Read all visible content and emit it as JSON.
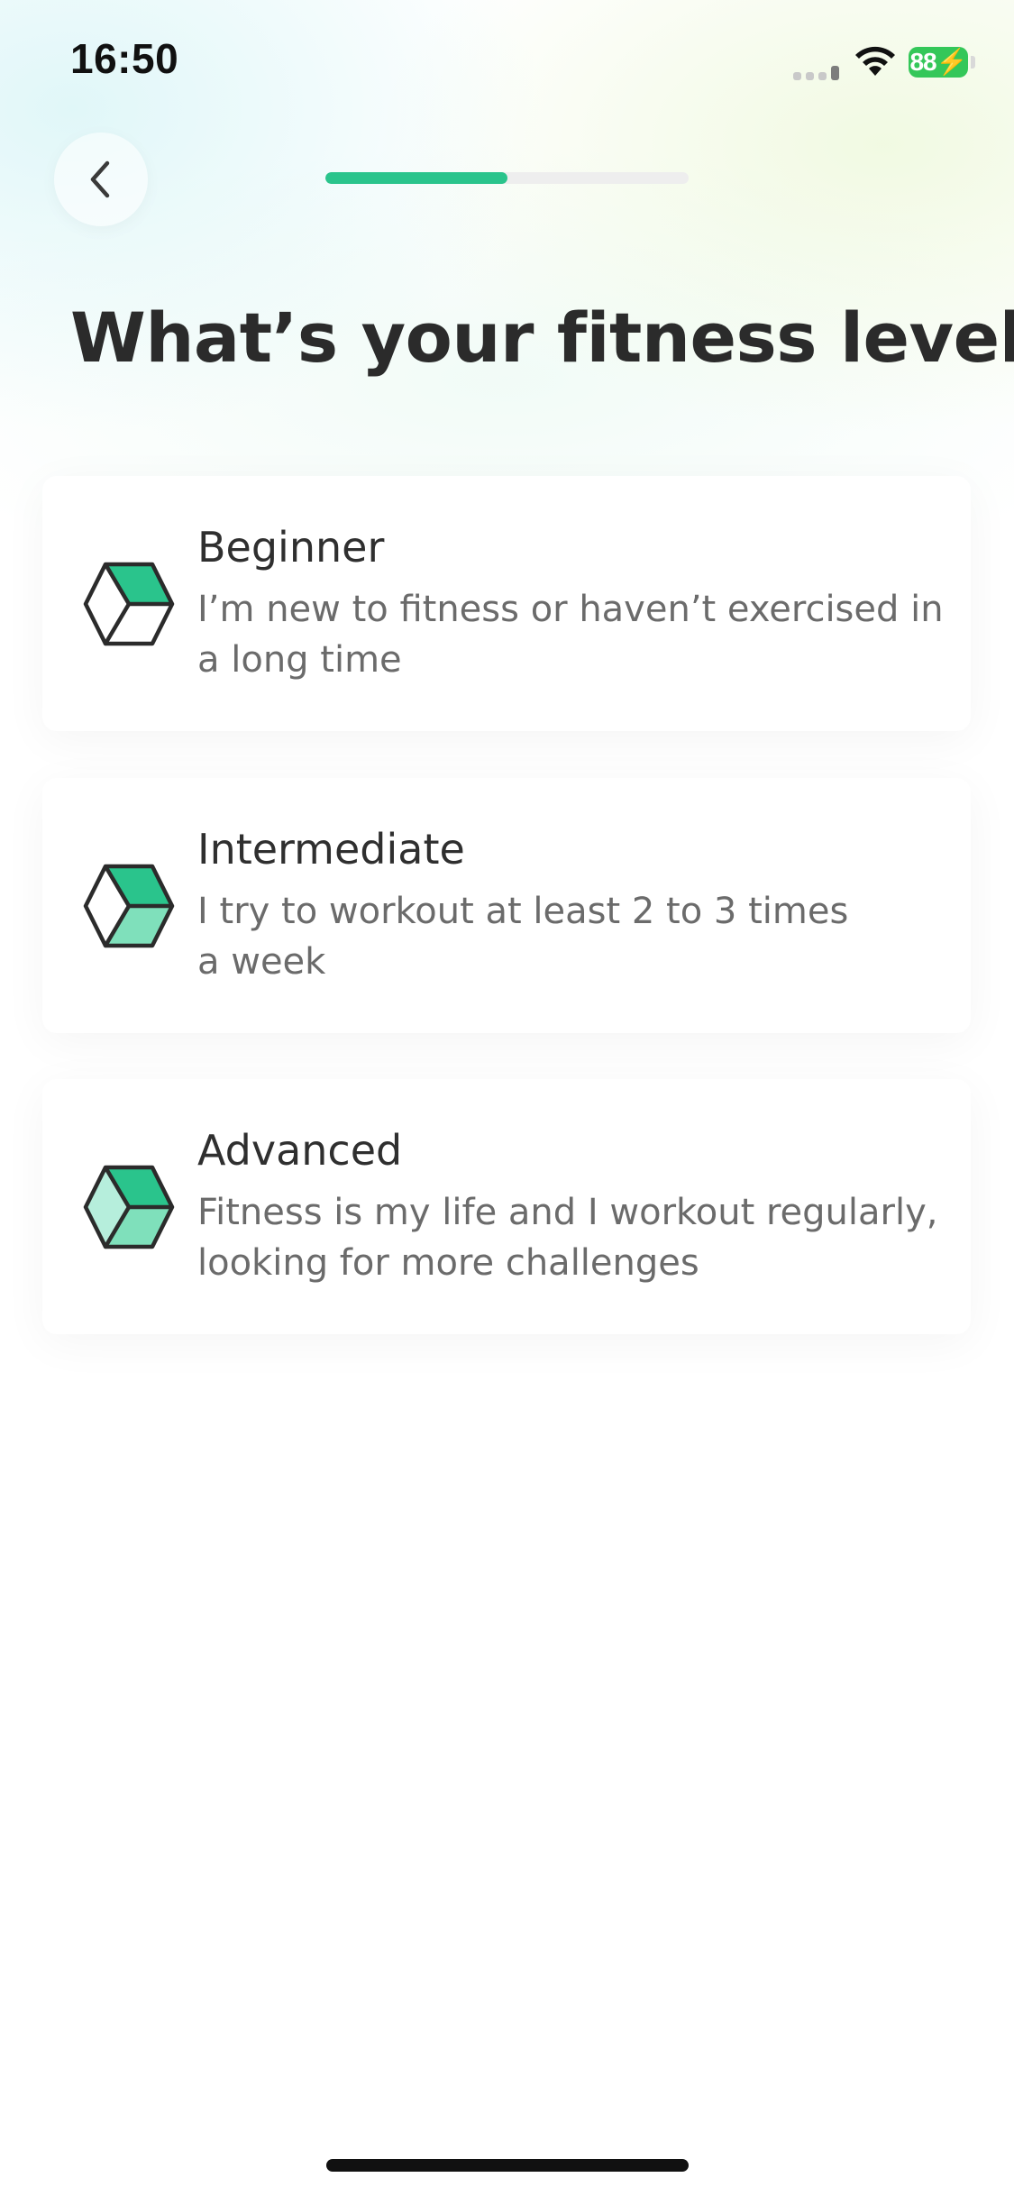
{
  "status_bar": {
    "time": "16:50",
    "battery": "88"
  },
  "header": {
    "back_icon": "chevron-left-icon",
    "progress_fraction": 0.5,
    "progress_color": "#2ac48c"
  },
  "title": "What’s your fitness level?",
  "levels": [
    {
      "title": "Beginner",
      "description_lines": [
        "I’m new to fitness or haven’t exercised in",
        "a long time"
      ],
      "icon": "cube-icon"
    },
    {
      "title": "Intermediate",
      "description_lines": [
        "I try to workout at least 2 to 3 times",
        "a week"
      ],
      "icon": "cube-icon"
    },
    {
      "title": "Advanced",
      "description_lines": [
        "Fitness is my life and I workout regularly,",
        "looking for more challenges"
      ],
      "icon": "cube-icon"
    }
  ],
  "colors": {
    "accent": "#2ac48c",
    "cube_light": "#7fe0bb",
    "cube_lighter": "#b6eedc",
    "text_dark": "#2b2b2b",
    "text_muted": "#6b6b6b"
  }
}
